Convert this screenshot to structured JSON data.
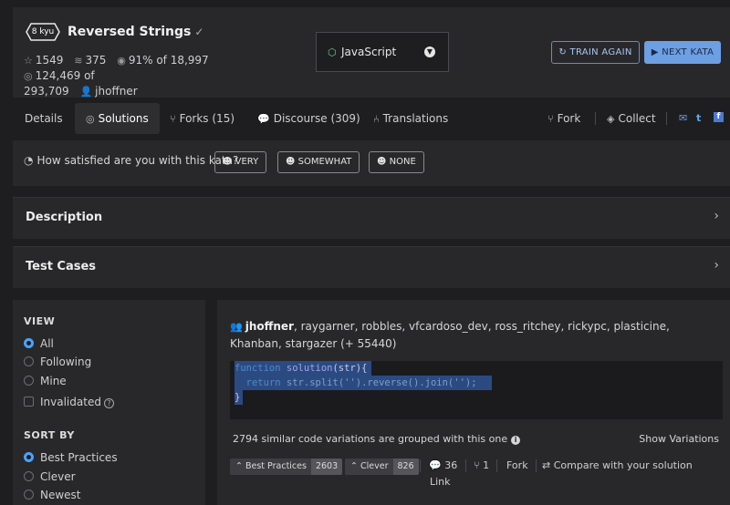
{
  "kata": {
    "rank": "8 kyu",
    "title": "Reversed Strings",
    "title_check": "✓",
    "stats": {
      "stars": "1549",
      "collections": "375",
      "satisfaction": "91%",
      "satisfaction_of": "of 18,997",
      "completed": "124,469",
      "completed_of": "of",
      "total": "293,709",
      "author": "jhoffner"
    }
  },
  "language": {
    "label": "JavaScript"
  },
  "actions": {
    "train_again": "TRAIN AGAIN",
    "next_kata": "NEXT KATA"
  },
  "tabs": {
    "details": "Details",
    "solutions": "Solutions",
    "forks": "Forks (15)",
    "discourse": "Discourse (309)",
    "translations": "Translations",
    "fork": "Fork",
    "collect": "Collect"
  },
  "survey": {
    "question": "How satisfied are you with this kata?",
    "very": "VERY",
    "somewhat": "SOMEWHAT",
    "none": "NONE"
  },
  "sections": {
    "description": "Description",
    "test_cases": "Test Cases"
  },
  "filters": {
    "view_heading": "VIEW",
    "view_all": "All",
    "view_following": "Following",
    "view_mine": "Mine",
    "invalidated": "Invalidated",
    "sort_heading": "SORT BY",
    "sort_best": "Best Practices",
    "sort_clever": "Clever",
    "sort_newest": "Newest"
  },
  "solution": {
    "author": "jhoffner",
    "others": ", raygarner, robbles, vfcardoso_dev, ross_ritchey, rickypc, plasticine, Khanban, stargazer (+ 55440)",
    "code": {
      "kw1": "function",
      "fname": "solution",
      "params": "(str){",
      "kw2": "return",
      "body": "str.split('').reverse().join('');",
      "close": "}"
    },
    "similar": "2794 similar code variations are grouped with this one",
    "show_variations": "Show Variations",
    "best_practices_label": "Best Practices",
    "best_practices_count": "2603",
    "clever_label": "Clever",
    "clever_count": "826",
    "comments": "36",
    "forks": "1",
    "fork": "Fork",
    "compare": "Compare with your solution",
    "link": "Link"
  },
  "colors": {
    "accent_blue": "#6d9fe3",
    "radio_blue": "#4aa3ff",
    "code_highlight": "#2c4a82"
  }
}
